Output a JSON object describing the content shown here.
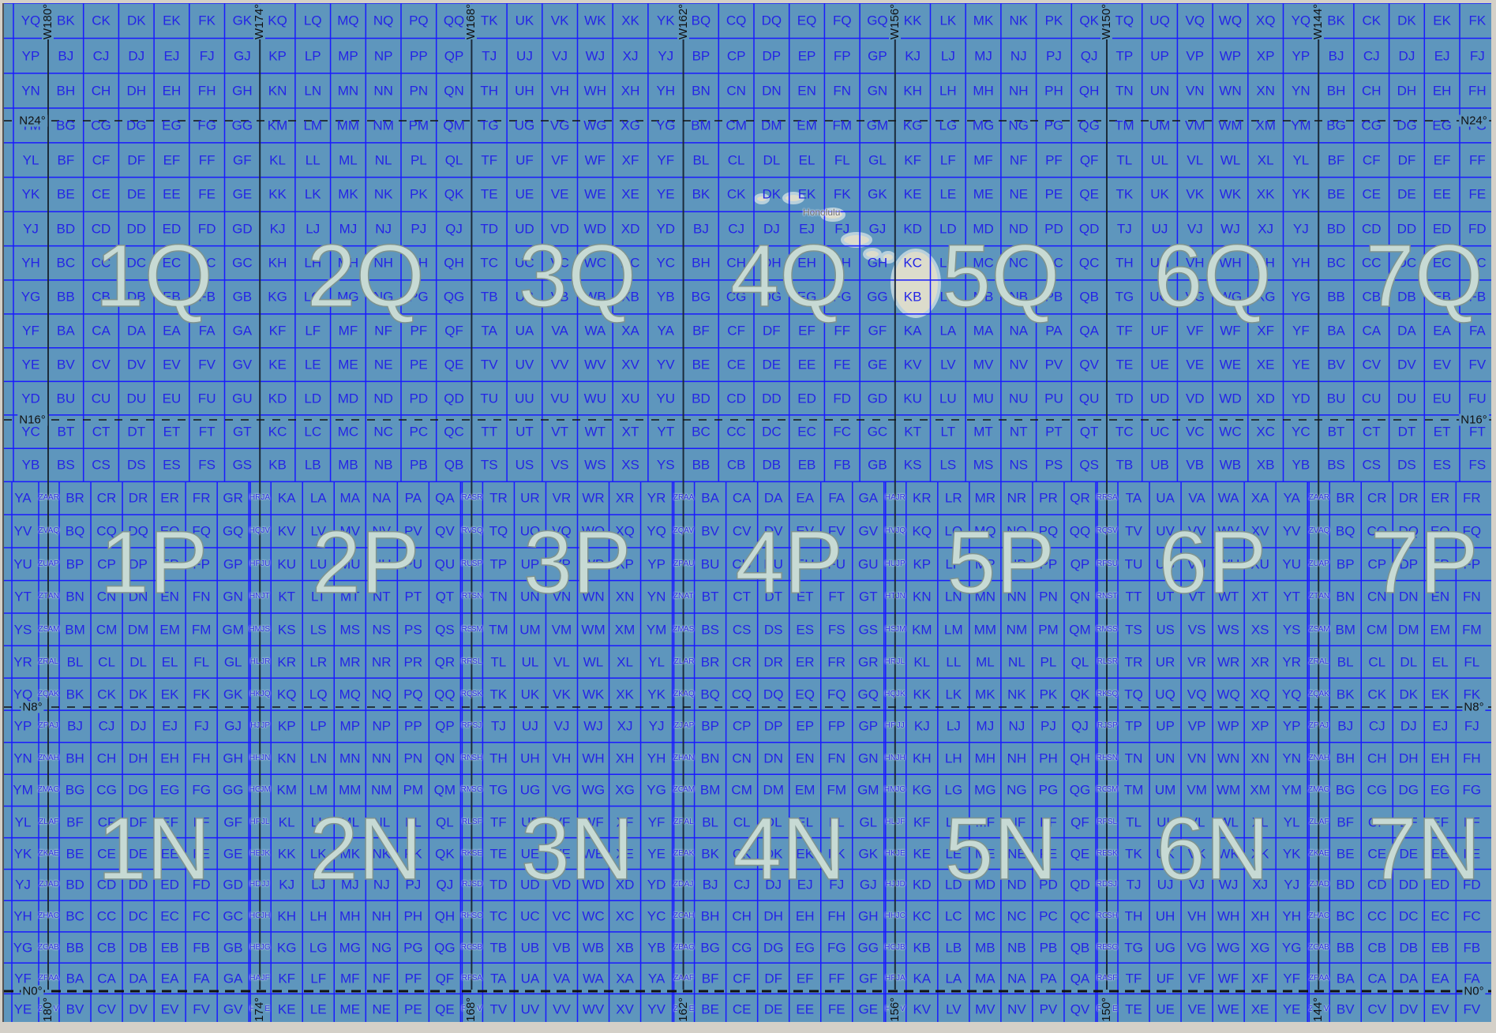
{
  "map_colors": {
    "water": "#5e96bd",
    "grid_line": "#1a1aff",
    "label": "#2424e6",
    "zone_label": "#c7dad4",
    "land": "#dcdccc",
    "zone_boundary": "#1c2b3a"
  },
  "longitude_labels": [
    "W180°",
    "W174°",
    "W168°",
    "W162°",
    "W156°",
    "W150°",
    "W144°"
  ],
  "latitude_labels": [
    "N24°",
    "N16°",
    "N8°",
    "N0°"
  ],
  "zone_labels": [
    [
      "1Q",
      "2Q",
      "3Q",
      "4Q",
      "5Q",
      "6Q",
      "7Q"
    ],
    [
      "1P",
      "2P",
      "3P",
      "4P",
      "5P",
      "6P",
      "7P"
    ],
    [
      "1N",
      "2N",
      "3N",
      "4N",
      "5N",
      "6N",
      "7N"
    ]
  ],
  "place_labels": [
    "Honolulu"
  ],
  "grid_rows": [
    {
      "cells": "YQ BK CK DK EK FK GK KQ LQ MQ NQ PQ QQ TK UK VK WK XK YK BQ CQ DQ EQ FQ GQ KK LK MK NK PK QK TQ UQ VQ WQ XQ YQ BK CK DK EK FK",
      "edges": ""
    },
    {
      "cells": "YP BJ CJ DJ EJ FJ GJ KP LP MP NP PP QP TJ UJ VJ WJ XJ YJ BP CP DP EP FP GP KJ LJ MJ NJ PJ QJ TP UP VP WP XP YP BJ CJ DJ EJ FJ",
      "edges": ""
    },
    {
      "cells": "YN BH CH DH EH FH GH KN LN MN NN PN QN TH UH VH WH XH YH BN CN DN EN FN GN KH LH MH NH PH QH TN UN VN WN XN YN BH CH DH EH FH",
      "edges": ""
    },
    {
      "cells": "YM BG CG DG EG FG GG KM LM MM NM PM QM TG UG VG WG XG YG BM CM DM EM FM GM KG LG MG NG PG QG TM UM VM WM XM YM BG CG DG EG FG",
      "edges": ""
    },
    {
      "cells": "YL BF CF DF EF FF GF KL LL ML NL PL QL TF UF VF WF XF YF BL CL DL EL FL GL KF LF MF NF PF QF TL UL VL WL XL YL BF CF DF EF FF",
      "edges": ""
    },
    {
      "cells": "YK BE CE DE EE FE GE KK LK MK NK PK QK TE UE VE WE XE YE BK CK DK EK FK GK KE LE ME NE PE QE TK UK VK WK XK YK BE CE DE EE FE",
      "edges": ""
    },
    {
      "cells": "YJ BD CD DD ED FD GD KJ LJ MJ NJ PJ QJ TD UD VD WD XD YD BJ CJ DJ EJ FJ GJ KD LD MD ND PD QD TJ UJ VJ WJ XJ YJ BD CD DD ED FD",
      "edges": ""
    },
    {
      "cells": "YH BC CC DC EC FC GC KH LH MH NH PH QH TC UC VC WC XC YC BH CH DH EH FH GH KC LC MC NC PC QC TH UH VH WH XH YH BC CC DC EC FC",
      "edges": ""
    },
    {
      "cells": "YG BB CB DB EB FB GB KG LG MG NG PG QG TB UB VB WB XB YB BG CG DG EG FG GG KB LB MB NB PB QB TG UG VG WG XG YG BB CB DB EB FB",
      "edges": ""
    },
    {
      "cells": "YF BA CA DA EA FA GA KF LF MF NF PF QF TA UA VA WA XA YA BF CF DF EF FF GF KA LA MA NA PA QA TF UF VF WF XF YF BA CA DA EA FA",
      "edges": ""
    },
    {
      "cells": "YE BV CV DV EV FV GV KE LE ME NE PE QE TV UV VV WV XV YV BE CE DE EE FE GE KV LV MV NV PV QV TE UE VE WE XE YE BV CV DV EV FV",
      "edges": ""
    },
    {
      "cells": "YD BU CU DU EU FU GU KD LD MD ND PD QD TU UU VU WU XU YU BD CD DD ED FD GD KU LU MU NU PU QU TD UD VD WD XD YD BU CU DU EU FU",
      "edges": ""
    },
    {
      "cells": "YC BT CT DT ET FT GT KC LC MC NC PC QC TT UT VT WT XT YT BC CC DC EC FC GC KT LT MT NT PT QT TC UC VC WC XC YC BT CT DT ET FT",
      "edges": ""
    },
    {
      "cells": "YB BS CS DS ES FS GS KB LB MB NB PB QB TS US VS WS XS YS BB CB DB EB FB GB KS LS MS NS PS QS TB UB VB WB XB YB BS CS DS ES FS",
      "edges": ""
    },
    {
      "cells": "YA BR CR DR ER FR GR KA LA MA NA PA QA TR UR VR WR XR YR BA CA DA EA FA GA KR LR MR NR PR QR TA UA VA WA XA YA BR CR DR ER FR",
      "edges": "ZA AR HR JA RA SR ZR AA HA JR RR SA ZA AR"
    },
    {
      "cells": "YV BQ CQ DQ EQ FQ GQ KV LV MV NV PV QV TQ UQ VQ WQ XQ YQ BV CV DV EV FV GV KQ LQ MQ NQ PQ QQ TV UV VV WV XV YV BQ CQ DQ EQ FQ",
      "edges": "ZV AQ HQ JV RV SQ ZQ AV HV JQ RQ SV ZV AQ"
    },
    {
      "cells": "YU BP CP DP EP FP GP KU LU MU NU PU QU TP UP VP WP XP YP BU CU DU EU FU GU KP LP MP NP PP QP TU UU VU WU XU YU BP CP DP EP FP",
      "edges": "ZU AP HP JU RU SP ZP AU HU JP RP SU ZU AP"
    },
    {
      "cells": "YT BN CN DN EN FN GN KT LT MT NT PT QT TN UN VN WN XN YN BT CT DT ET FT GT KN LN MN NN PN QN TT UT VT WT XT YT BN CN DN EN FN",
      "edges": "ZT AN HN JT RT SN ZN AT HT JN RN ST ZT AN"
    },
    {
      "cells": "YS BM CM DM EM FM GM KS LS MS NS PS QS TM UM VM WM XM YM BS CS DS ES FS GS KM LM MM NM PM QM TS US VS WS XS YS BM CM DM EM FM",
      "edges": "ZS AM HM JS RS SM ZM AS HS JM RM SS ZS AM"
    },
    {
      "cells": "YR BL CL DL EL FL GL KR LR MR NR PR QR TL UL VL WL XL YL BR CR DR ER FR GR KL LL ML NL PL QL TR UR VR WR XR YR BL CL DL EL FL",
      "edges": "ZR AL HL JR RR SL ZL AR HR JL RL SR ZR AL"
    },
    {
      "cells": "YQ BK CK DK EK FK GK KQ LQ MQ NQ PQ QQ TK UK VK WK XK YK BQ CQ DQ EQ FQ GQ KK LK MK NK PK QK TQ UQ VQ WQ XQ YQ BK CK DK EK FK",
      "edges": "ZQ AK HK JQ RQ SK ZK AQ HQ JK RK SQ ZQ AK"
    },
    {
      "cells": "YP BJ CJ DJ EJ FJ GJ KP LP MP NP PP QP TJ UJ VJ WJ XJ YJ BP CP DP EP FP GP KJ LJ MJ NJ PJ QJ TP UP VP WP XP YP BJ CJ DJ EJ FJ",
      "edges": "ZP AJ HJ JP RP SJ ZJ AP HP JJ RJ SP ZP AJ"
    },
    {
      "cells": "YN BH CH DH EH FH GH KN LN MN NN PN QN TH UH VH WH XH YH BN CN DN EN FN GN KH LH MH NH PH QH TN UN VN WN XN YN BH CH DH EH FH",
      "edges": "ZN AH HH JN RN SH ZH AN HN JH RH SN ZN AH"
    },
    {
      "cells": "YM BG CG DG EG FG GG KM LM MM NM PM QM TG UG VG WG XG YG BM CM DM EM FM GM KG LG MG NG PG QG TM UM VM WM XM YM BG CG DG EG FG",
      "edges": "ZM AG HG JM RM SG ZG AM HM JG RG SM ZM AG"
    },
    {
      "cells": "YL BF CF DF EF FF GF KL LL ML NL PL QL TF UF VF WF XF YF BL CL DL EL FL GL KF LF MF NF PF QF TL UL VL WL XL YL BF CF DF EF FF",
      "edges": "ZL AF HF JL RL SF ZF AL HL JF RF SL ZL AF"
    },
    {
      "cells": "YK BE CE DE EE FE GE KK LK MK NK PK QK TE UE VE WE XE YE BK CK DK EK FK GK KE LE ME NE PE QE TK UK VK WK XK YK BE CE DE EE FE",
      "edges": "ZK AE HE JK RK SE ZE AK HK JE RE SK ZK AE"
    },
    {
      "cells": "YJ BD CD DD ED FD GD KJ LJ MJ NJ PJ QJ TD UD VD WD XD YD BJ CJ DJ EJ FJ GJ KD LD MD ND PD QD TJ UJ VJ WJ XJ YJ BD CD DD ED FD",
      "edges": "ZJ AD HD JJ RJ SD ZD AJ HJ JD RD SJ ZJ AD"
    },
    {
      "cells": "YH BC CC DC EC FC GC KH LH MH NH PH QH TC UC VC WC XC YC BH CH DH EH FH GH KC LC MC NC PC QC TH UH VH WH XH YH BC CC DC EC FC",
      "edges": "ZH AC HC JH RH SC ZC AH HH JC RC SH ZH AC"
    },
    {
      "cells": "YG BB CB DB EB FB GB KG LG MG NG PG QG TB UB VB WB XB YB BG CG DG EG FG GG KB LB MB NB PB QB TG UG VG WG XG YG BB CB DB EB FB",
      "edges": "ZG AB HB JG RG SB ZB AG HG JB RB SG ZG AB"
    },
    {
      "cells": "YF BA CA DA EA FA GA KF LF MF NF PF QF TA UA VA WA XA YA BF CF DF EF FF GF KA LA MA NA PA QA TF UF VF WF XF YF BA CA DA EA FA",
      "edges": "ZF AA HA JF RF SA ZA AF HF JA RA SF ZF AA"
    },
    {
      "cells": "YE BV CV DV EV FV GV KE LE ME NE PE QE TV UV VV WV XV YV BE CE DE EE FE GE KV LV MV NV PV QV TE UE VE WE XE YE BV CV DV EV FV",
      "edges": "ZE AV HV JE RE SV ZV AE HE JV RV SE ZE AV"
    }
  ]
}
